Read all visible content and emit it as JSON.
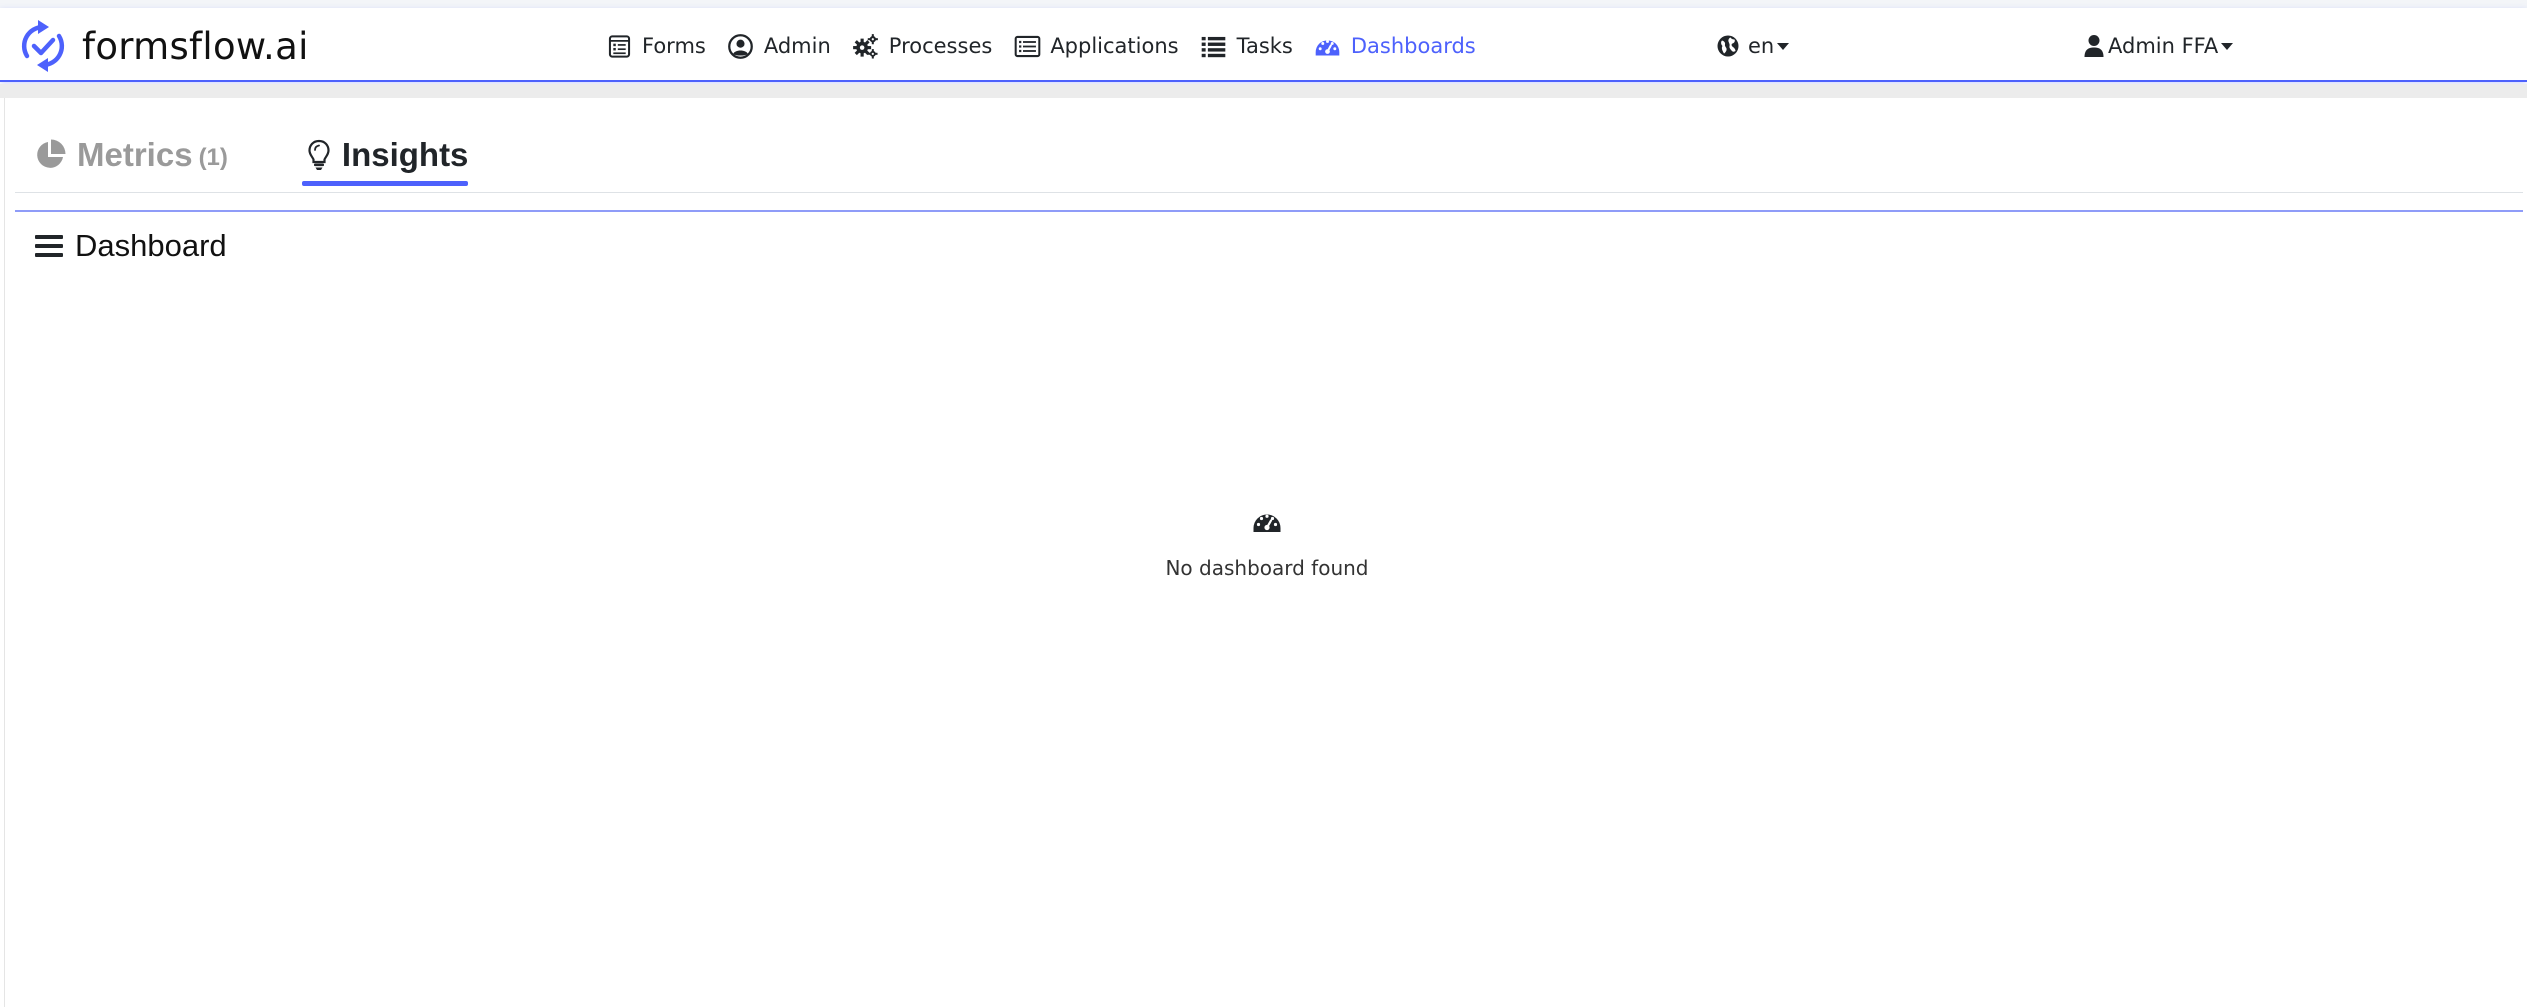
{
  "brand": {
    "name": "formsflow.ai",
    "icon": "refresh-check-logo-icon"
  },
  "nav": {
    "items": [
      {
        "label": "Forms",
        "icon": "form-list-icon",
        "active": false
      },
      {
        "label": "Admin",
        "icon": "user-circle-icon",
        "active": false
      },
      {
        "label": "Processes",
        "icon": "gears-icon",
        "active": false
      },
      {
        "label": "Applications",
        "icon": "list-window-icon",
        "active": false
      },
      {
        "label": "Tasks",
        "icon": "task-list-icon",
        "active": false
      },
      {
        "label": "Dashboards",
        "icon": "gauge-icon",
        "active": true
      }
    ],
    "language": {
      "label": "en",
      "icon": "globe-icon"
    },
    "user": {
      "label": "Admin FFA",
      "icon": "user-icon"
    }
  },
  "tabs": {
    "metrics": {
      "label": "Metrics",
      "count": "(1)",
      "icon": "pie-chart-icon"
    },
    "insights": {
      "label": "Insights",
      "icon": "lightbulb-icon"
    }
  },
  "dashboard": {
    "title": "Dashboard",
    "title_icon": "hamburger-icon",
    "empty_message": "No dashboard found",
    "empty_icon": "gauge-icon"
  },
  "colors": {
    "accent": "#4d61fc",
    "muted_tab": "#9a9a9a",
    "text": "#212529"
  }
}
